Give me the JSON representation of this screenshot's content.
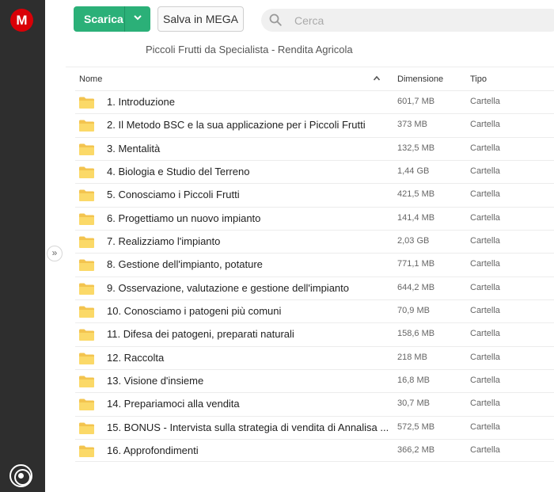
{
  "sidebar": {
    "logo_text": "M",
    "logo_color": "#d90007",
    "toggle_icon": "double-chevron-right-icon"
  },
  "toolbar": {
    "download_label": "Scarica",
    "save_label": "Salva in MEGA",
    "accent": "#2bb078"
  },
  "search": {
    "placeholder": "Cerca",
    "value": ""
  },
  "breadcrumb": "Piccoli Frutti da Specialista - Rendita Agricola",
  "columns": {
    "name": "Nome",
    "size": "Dimensione",
    "type": "Tipo"
  },
  "rows": [
    {
      "name": "1. Introduzione",
      "size": "601,7 MB",
      "type": "Cartella"
    },
    {
      "name": "2. Il Metodo BSC e la sua applicazione per i Piccoli Frutti",
      "size": "373 MB",
      "type": "Cartella"
    },
    {
      "name": "3. Mentalità",
      "size": "132,5 MB",
      "type": "Cartella"
    },
    {
      "name": "4. Biologia e Studio del Terreno",
      "size": "1,44 GB",
      "type": "Cartella"
    },
    {
      "name": "5. Conosciamo i Piccoli Frutti",
      "size": "421,5 MB",
      "type": "Cartella"
    },
    {
      "name": "6. Progettiamo un nuovo impianto",
      "size": "141,4 MB",
      "type": "Cartella"
    },
    {
      "name": "7. Realizziamo l'impianto",
      "size": "2,03 GB",
      "type": "Cartella"
    },
    {
      "name": "8. Gestione dell'impianto, potature",
      "size": "771,1 MB",
      "type": "Cartella"
    },
    {
      "name": "9. Osservazione, valutazione e gestione dell'impianto",
      "size": "644,2 MB",
      "type": "Cartella"
    },
    {
      "name": "10. Conosciamo i patogeni più comuni",
      "size": "70,9 MB",
      "type": "Cartella"
    },
    {
      "name": "11. Difesa dei patogeni, preparati naturali",
      "size": "158,6 MB",
      "type": "Cartella"
    },
    {
      "name": "12. Raccolta",
      "size": "218 MB",
      "type": "Cartella"
    },
    {
      "name": "13. Visione d'insieme",
      "size": "16,8 MB",
      "type": "Cartella"
    },
    {
      "name": "14. Prepariamoci alla vendita",
      "size": "30,7 MB",
      "type": "Cartella"
    },
    {
      "name": "15. BONUS - Intervista sulla strategia di vendita di Annalisa ...",
      "size": "572,5 MB",
      "type": "Cartella"
    },
    {
      "name": "16. Approfondimenti",
      "size": "366,2 MB",
      "type": "Cartella"
    }
  ]
}
